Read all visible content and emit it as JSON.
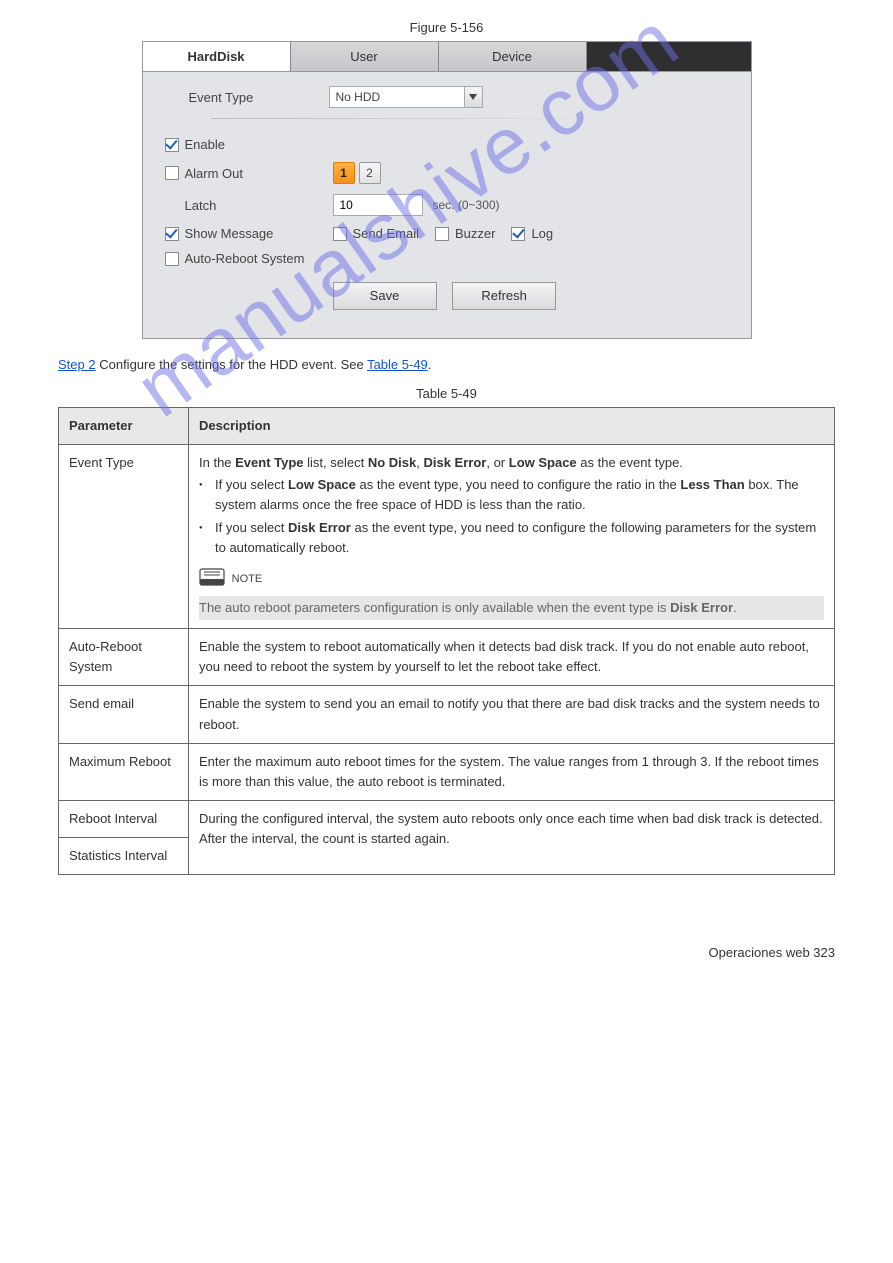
{
  "figure": {
    "label": "Figure 5-156"
  },
  "ui": {
    "tabs": {
      "hard_disk": "HardDisk",
      "user": "User",
      "device": "Device"
    },
    "event_type_label": "Event Type",
    "event_type_value": "No HDD",
    "enable": "Enable",
    "alarm_out": "Alarm Out",
    "alarm1": "1",
    "alarm2": "2",
    "latch_label": "Latch",
    "latch_value": "10",
    "latch_suffix": "sec. (0~300)",
    "show_message": "Show Message",
    "send_email": "Send Email",
    "buzzer": "Buzzer",
    "log": "Log",
    "auto_reboot": "Auto-Reboot System",
    "save": "Save",
    "refresh": "Refresh"
  },
  "step": {
    "prefix": "Step 2",
    "text": "Configure the settings for the HDD event. See ",
    "link": "Table 5-49",
    "suffix": "."
  },
  "table_caption": "Table 5-49",
  "table": {
    "header_param": "Parameter",
    "header_desc": "Description",
    "rows": [
      {
        "param": "Event Type",
        "desc_intro": "In the ",
        "desc_bold1": "Event Type",
        "desc_mid": " list, select ",
        "desc_bold2": "No Disk",
        "desc_mid2": ", ",
        "desc_bold3": "Disk Error",
        "desc_mid3": ", or ",
        "desc_bold4": "Low Space",
        "desc_mid4": " as the event type.",
        "bullet1a": "If you select ",
        "bullet1b": "Low Space",
        "bullet1c": " as the event type, you need to configure the ratio in the ",
        "bullet1d": "Less Than",
        "bullet1e": " box. The system alarms once the free space of HDD is less than the ratio.",
        "bullet2a": "If you select ",
        "bullet2b": "Disk Error",
        "bullet2c": " as the event type, you need to configure the following parameters for the system to automatically reboot.",
        "note_label": "NOTE",
        "note_shaded1": "The auto reboot parameters configuration is only available when the event type is ",
        "note_bold": "Disk Error",
        "note_shaded2": "."
      },
      {
        "param": "Auto-Reboot System",
        "desc1": "Enable the system to reboot automatically when it detects bad disk track. If you do not enable auto reboot, you need to reboot the system by yourself to let the reboot take effect."
      },
      {
        "param": "Send email",
        "desc1": "Enable the system to send you an email to notify you that there are bad disk tracks and the system needs to reboot."
      },
      {
        "param": "Maximum Reboot",
        "desc1": "Enter the maximum auto reboot times for the system. The value ranges from 1 through 3. If the reboot times is more than this value, the auto reboot is terminated."
      },
      {
        "param": "Reboot Interval",
        "merge_next": true
      },
      {
        "param": "Statistics Interval",
        "desc_shared": "During the configured interval, the system auto reboots only once each time when bad disk track is detected. After the interval, the count is started again."
      }
    ]
  },
  "watermark": "manualshive.com",
  "footer": "Operaciones web 323"
}
